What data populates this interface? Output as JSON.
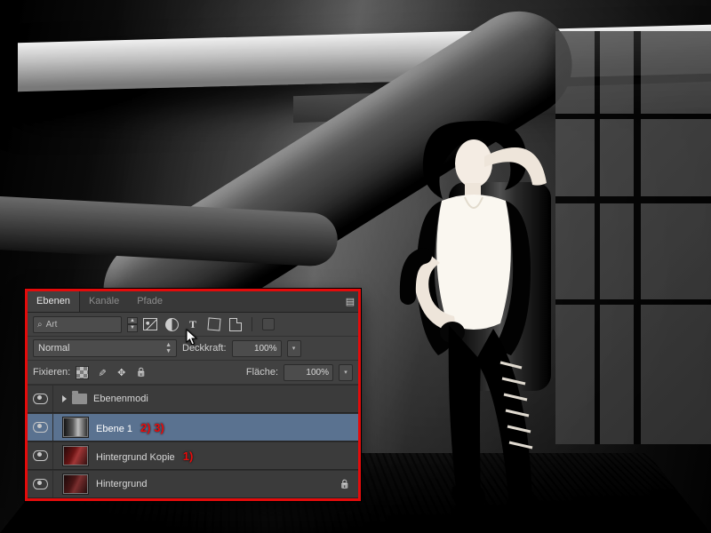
{
  "panel": {
    "tabs": {
      "layers": "Ebenen",
      "channels": "Kanäle",
      "paths": "Pfade"
    },
    "search_placeholder": "Art",
    "blend_mode": "Normal",
    "opacity_label": "Deckkraft:",
    "opacity_value": "100%",
    "lock_label": "Fixieren:",
    "fill_label": "Fläche:",
    "fill_value": "100%"
  },
  "layers": [
    {
      "kind": "group",
      "name": "Ebenenmodi",
      "visible": true
    },
    {
      "kind": "pixel",
      "name": "Ebene 1",
      "visible": true,
      "selected": true,
      "thumb": "bw",
      "annotation": "2) 3)"
    },
    {
      "kind": "pixel",
      "name": "Hintergrund Kopie",
      "visible": true,
      "thumb": "color",
      "annotation": "1)"
    },
    {
      "kind": "pixel",
      "name": "Hintergrund",
      "visible": true,
      "thumb": "orig",
      "locked": true
    }
  ],
  "icons": {
    "search": "search-icon",
    "image_filter": "image-icon",
    "adjust_filter": "adjustment-icon",
    "type_filter": "type-icon",
    "shape_filter": "shape-icon",
    "smart_filter": "smartobject-icon",
    "color_swatch": "color-swatch-icon",
    "panel_menu": "panel-menu-icon",
    "lock_trans": "lock-transparency-icon",
    "lock_pixels": "lock-pixels-icon",
    "lock_pos": "lock-position-icon",
    "lock_all": "lock-all-icon",
    "eye": "visibility-eye-icon",
    "folder": "folder-icon",
    "disclosure": "disclosure-triangle-icon",
    "stepper": "stepper-icon",
    "dropdown": "dropdown-arrows-icon",
    "lock_mark": "lock-indicator-icon",
    "cursor": "mouse-cursor-icon"
  }
}
